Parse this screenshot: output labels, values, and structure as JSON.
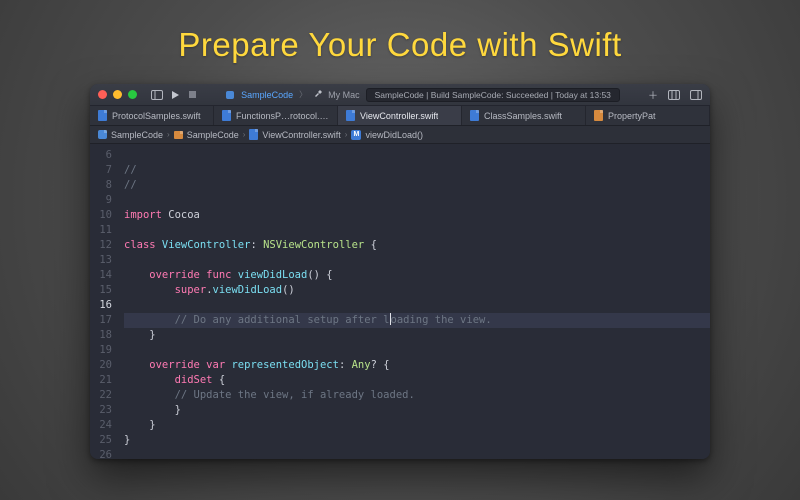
{
  "slogan": "Prepare Your Code with Swift",
  "titlebar": {
    "scheme_left": "SampleCode",
    "scheme_right": "My Mac",
    "status": "SampleCode | Build SampleCode: Succeeded | Today at 13:53"
  },
  "tabs": [
    {
      "label": "ProtocolSamples.swift",
      "active": false
    },
    {
      "label": "FunctionsP…rotocol.swift",
      "active": false
    },
    {
      "label": "ViewController.swift",
      "active": true
    },
    {
      "label": "ClassSamples.swift",
      "active": false
    },
    {
      "label": "PropertyPat",
      "active": false
    }
  ],
  "jump": {
    "seg1": "SampleCode",
    "seg2": "SampleCode",
    "seg3": "ViewController.swift",
    "seg4": "viewDidLoad()"
  },
  "lines": [
    "6",
    "7",
    "8",
    "9",
    "10",
    "11",
    "12",
    "13",
    "14",
    "15",
    "16",
    "17",
    "18",
    "19",
    "20",
    "21",
    "22",
    "23",
    "24",
    "25",
    "26"
  ],
  "code": {
    "l6": "//",
    "l7": "//",
    "l8": "",
    "l9a": "import",
    "l9b": " Cocoa",
    "l10": "",
    "l11a": "class",
    "l11b": " ViewController",
    "l11c": ": ",
    "l11d": "NSViewController",
    "l11e": " {",
    "l12": "",
    "l13a": "    override",
    "l13b": " func",
    "l13c": " viewDidLoad",
    "l13d": "() {",
    "l14a": "        super",
    "l14b": ".",
    "l14c": "viewDidLoad",
    "l14d": "()",
    "l15": "",
    "l16a": "        // Do any additional setup after l",
    "l16b": "oading the view.",
    "l17": "    }",
    "l18": "",
    "l19a": "    override",
    "l19b": " var",
    "l19c": " representedObject",
    "l19d": ": ",
    "l19e": "Any",
    "l19f": "? {",
    "l20a": "        didSet",
    "l20b": " {",
    "l21": "        // Update the view, if already loaded.",
    "l22": "        }",
    "l23": "    }",
    "l24": "}",
    "l25": "",
    "l26": ""
  }
}
